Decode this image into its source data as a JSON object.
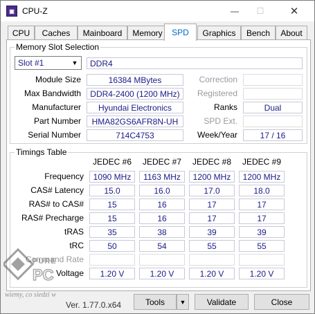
{
  "window": {
    "title": "CPU-Z",
    "minimize": "—",
    "maximize": "☐",
    "close": "✕"
  },
  "tabs": [
    {
      "label": "CPU"
    },
    {
      "label": "Caches"
    },
    {
      "label": "Mainboard"
    },
    {
      "label": "Memory"
    },
    {
      "label": "SPD",
      "active": true
    },
    {
      "label": "Graphics"
    },
    {
      "label": "Bench"
    },
    {
      "label": "About"
    }
  ],
  "slot": {
    "group_title": "Memory Slot Selection",
    "selected": "Slot #1",
    "type": "DDR4",
    "module_size_label": "Module Size",
    "module_size": "16384 MBytes",
    "max_bandwidth_label": "Max Bandwidth",
    "max_bandwidth": "DDR4-2400 (1200 MHz)",
    "manufacturer_label": "Manufacturer",
    "manufacturer": "Hyundai Electronics",
    "part_number_label": "Part Number",
    "part_number": "HMA82GS6AFR8N-UH",
    "serial_number_label": "Serial Number",
    "serial_number": "714C4753",
    "correction_label": "Correction",
    "correction": "",
    "registered_label": "Registered",
    "registered": "",
    "ranks_label": "Ranks",
    "ranks": "Dual",
    "spd_ext_label": "SPD Ext.",
    "spd_ext": "",
    "week_year_label": "Week/Year",
    "week_year": "17 / 16"
  },
  "timings": {
    "group_title": "Timings Table",
    "columns": [
      "JEDEC #6",
      "JEDEC #7",
      "JEDEC #8",
      "JEDEC #9"
    ],
    "rows": [
      {
        "label": "Frequency",
        "values": [
          "1090 MHz",
          "1163 MHz",
          "1200 MHz",
          "1200 MHz"
        ]
      },
      {
        "label": "CAS# Latency",
        "values": [
          "15.0",
          "16.0",
          "17.0",
          "18.0"
        ]
      },
      {
        "label": "RAS# to CAS#",
        "values": [
          "15",
          "16",
          "17",
          "17"
        ]
      },
      {
        "label": "RAS# Precharge",
        "values": [
          "15",
          "16",
          "17",
          "17"
        ]
      },
      {
        "label": "tRAS",
        "values": [
          "35",
          "38",
          "39",
          "39"
        ]
      },
      {
        "label": "tRC",
        "values": [
          "50",
          "54",
          "55",
          "55"
        ]
      },
      {
        "label": "Command Rate",
        "dim": true,
        "values": [
          "",
          "",
          "",
          ""
        ]
      },
      {
        "label": "Voltage",
        "values": [
          "1.20 V",
          "1.20 V",
          "1.20 V",
          "1.20 V"
        ]
      }
    ]
  },
  "footer": {
    "version": "Ver. 1.77.0.x64",
    "tools_label": "Tools",
    "validate_label": "Validate",
    "close_label": "Close"
  },
  "watermark": {
    "text": "PURE PC",
    "tagline": "wiemy, co siedzi w"
  }
}
